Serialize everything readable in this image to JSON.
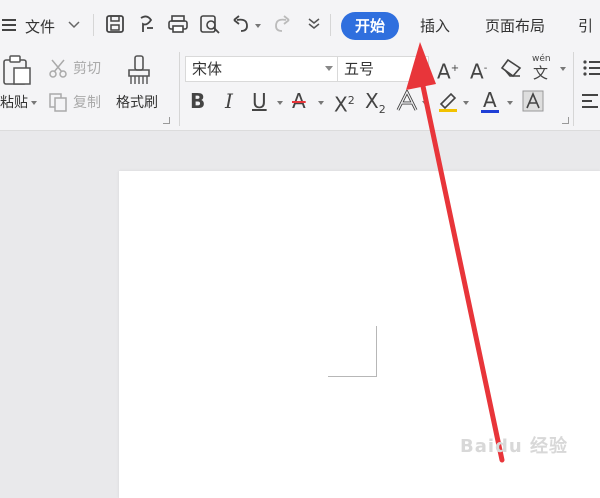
{
  "menu": {
    "file_label": "文件",
    "tabs": [
      {
        "label": "开始",
        "active": true
      },
      {
        "label": "插入",
        "active": false
      },
      {
        "label": "页面布局",
        "active": false
      },
      {
        "label": "引",
        "active": false
      }
    ]
  },
  "clipboard": {
    "paste_label": "粘贴",
    "cut_label": "剪切",
    "copy_label": "复制",
    "format_painter_label": "格式刷"
  },
  "font": {
    "family_value": "宋体",
    "size_value": "五号",
    "pinyin_label": "wén"
  },
  "watermark_text": "Baidu 经验",
  "colors": {
    "accent": "#2f6fde",
    "annotation_arrow": "#e8353a",
    "font_color_underline": "#1f3fd6",
    "highlight_underline": "#f2c200",
    "text_red_a": "#e8353a"
  }
}
